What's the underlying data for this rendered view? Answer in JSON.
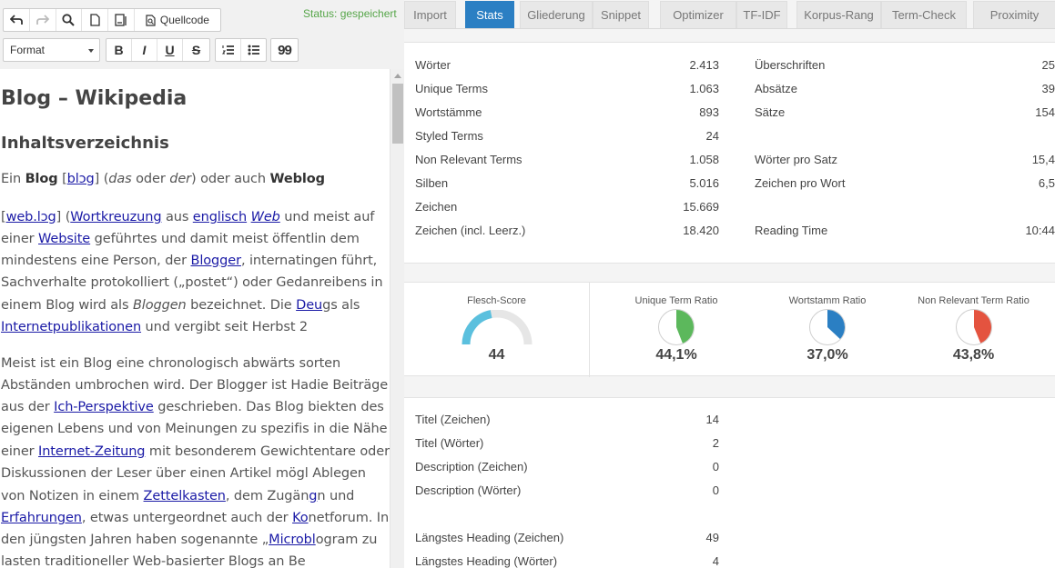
{
  "toolbar": {
    "status": "Status: gespeichert",
    "source_label": "Quellcode",
    "format_label": "Format",
    "bold_label": "B",
    "italic_label": "I",
    "underline_label": "U",
    "strike_label": "S",
    "quote_label": "99"
  },
  "editor": {
    "title": "Blog – Wikipedia",
    "toc_heading": "Inhaltsverzeichnis",
    "lines": [
      [
        "Ein ",
        {
          "b": "Blog"
        },
        " [",
        {
          "a": "blɔg"
        },
        "] (",
        {
          "i": "das"
        },
        " oder ",
        {
          "i": "der"
        },
        ") oder auch ",
        {
          "b": "Weblog"
        }
      ],
      [
        "[",
        {
          "a": "web.lɔg"
        },
        "] (",
        {
          "a": "Wortkreuzung"
        },
        " aus ",
        {
          "a": "englisch"
        },
        " ",
        {
          "ai": "Web"
        },
        " und ",
        " meist auf"
      ],
      [
        "einer ",
        {
          "a": "Website"
        },
        " geführtes und damit meist öffentl",
        "in dem"
      ],
      [
        "mindestens eine Person, der ",
        {
          "a": "Blogger"
        },
        ", internati",
        "ngen führt,"
      ],
      [
        "Sachverhalte protokolliert („postet“) oder Gedan",
        "reibens in"
      ],
      [
        "einem Blog wird als ",
        {
          "i": "Bloggen"
        },
        " bezeichnet. Die ",
        {
          "a": "Deu"
        },
        "gs als"
      ],
      [
        {
          "a": "Internetpublikationen"
        },
        " und vergibt seit Herbst 2"
      ],
      [
        "Meist ist ein Blog eine chronologisch abwärts so",
        "rten"
      ],
      [
        "Abständen umbrochen wird. Der Blogger ist Ha",
        "die Beiträge"
      ],
      [
        "aus der ",
        {
          "a": "Ich-Perspektive"
        },
        " geschrieben. Das Blog bi",
        "ekten des"
      ],
      [
        "eigenen Lebens und von Meinungen zu spezifis",
        " in die Nähe"
      ],
      [
        "einer ",
        {
          "a": "Internet-Zeitung"
        },
        " mit besonderem Gewichten",
        "tare oder"
      ],
      [
        "Diskussionen der Leser über einen Artikel mögl",
        " Ablegen"
      ],
      [
        "von Notizen in einem ",
        {
          "a": "Zettelkasten"
        },
        ", dem Zugän",
        {
          "a": "g"
        },
        "n und"
      ],
      [
        {
          "a": "Erfahrungen"
        },
        ", etwas untergeordnet auch der ",
        {
          "a": "Ko"
        },
        "netforum",
        ". In"
      ],
      [
        "den jüngsten Jahren haben sogenannte „",
        {
          "a": "Microbl"
        },
        "ogram",
        " zu"
      ],
      [
        "lasten traditioneller Web-basierter Blogs an Be"
      ]
    ]
  },
  "tabs": [
    {
      "label": "Import",
      "active": false
    },
    {
      "label": "Stats",
      "active": true
    },
    {
      "label": "Gliederung",
      "active": false
    },
    {
      "label": "Snippet",
      "active": false
    },
    {
      "label": "Optimizer",
      "active": false
    },
    {
      "label": "TF-IDF",
      "active": false
    },
    {
      "label": "Korpus-Rang",
      "active": false
    },
    {
      "label": "Term-Check",
      "active": false
    },
    {
      "label": "Proximity",
      "active": false
    }
  ],
  "stats_left": [
    {
      "label": "Wörter",
      "value": "2.413"
    },
    {
      "label": "Unique Terms",
      "value": "1.063"
    },
    {
      "label": "Wortstämme",
      "value": "893"
    },
    {
      "label": "Styled Terms",
      "value": "24"
    },
    {
      "label": "Non Relevant Terms",
      "value": "1.058"
    },
    {
      "label": "Silben",
      "value": "5.016"
    },
    {
      "label": "Zeichen",
      "value": "15.669"
    },
    {
      "label": "Zeichen (incl. Leerz.)",
      "value": "18.420"
    }
  ],
  "stats_right": [
    {
      "label": "Überschriften",
      "value": "25"
    },
    {
      "label": "Absätze",
      "value": "39"
    },
    {
      "label": "Sätze",
      "value": "154"
    },
    {
      "label": "",
      "value": ""
    },
    {
      "label": "Wörter pro Satz",
      "value": "15,4"
    },
    {
      "label": "Zeichen pro Wort",
      "value": "6,5"
    },
    {
      "label": "",
      "value": ""
    },
    {
      "label": "Reading Time",
      "value": "10:44"
    }
  ],
  "gauges": {
    "flesch": {
      "label": "Flesch-Score",
      "value": "44",
      "score": 44,
      "color": "#5bc0de"
    },
    "pies": [
      {
        "label": "Unique Term Ratio",
        "value": "44,1%",
        "ratio": 0.441,
        "color": "#5cb85c"
      },
      {
        "label": "Wortstamm Ratio",
        "value": "37,0%",
        "ratio": 0.37,
        "color": "#2b7fc3"
      },
      {
        "label": "Non Relevant Term Ratio",
        "value": "43,8%",
        "ratio": 0.438,
        "color": "#e4533f"
      }
    ]
  },
  "meta": [
    {
      "label": "Titel (Zeichen)",
      "value": "14"
    },
    {
      "label": "Titel (Wörter)",
      "value": "2"
    },
    {
      "label": "Description (Zeichen)",
      "value": "0"
    },
    {
      "label": "Description (Wörter)",
      "value": "0"
    },
    {
      "label": "",
      "value": ""
    },
    {
      "label": "Längstes Heading (Zeichen)",
      "value": "49"
    },
    {
      "label": "Längstes Heading (Wörter)",
      "value": "4"
    }
  ]
}
